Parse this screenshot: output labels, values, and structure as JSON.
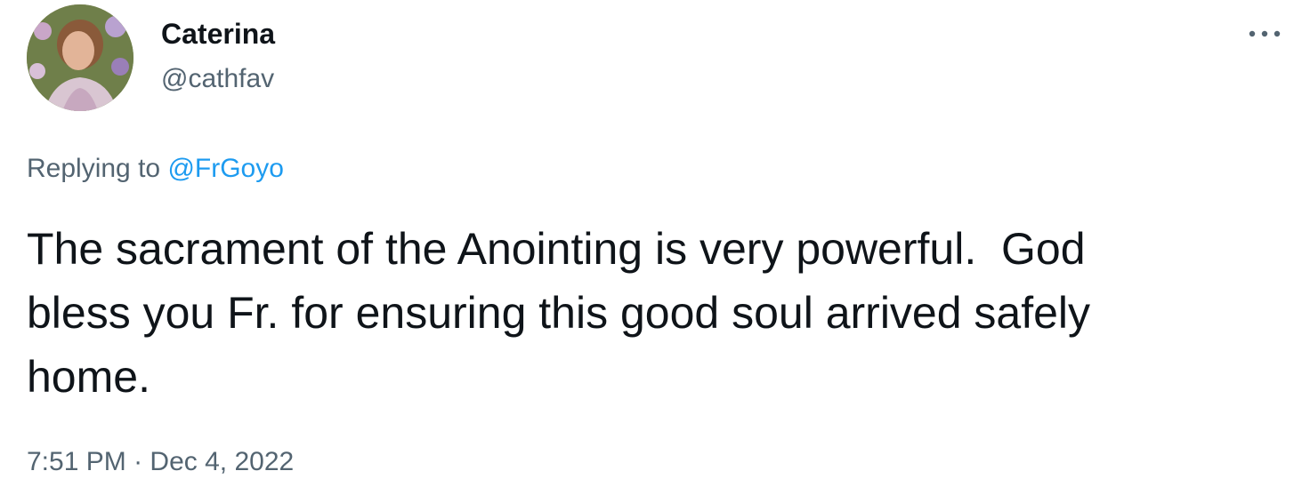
{
  "tweet": {
    "author": {
      "display_name": "Caterina",
      "handle": "@cathfav",
      "avatar_icon": "profile-photo"
    },
    "more_icon": "ellipsis-icon",
    "reply": {
      "prefix": "Replying to ",
      "mention": "@FrGoyo"
    },
    "text": "The sacrament of the Anointing is very powerful.  God\nbless you Fr. for ensuring this good soul arrived safely\nhome.",
    "time": "7:51 PM",
    "separator": " · ",
    "date": "Dec 4, 2022"
  },
  "colors": {
    "text_primary": "#0f1419",
    "text_secondary": "#536471",
    "link": "#1d9bf0",
    "background": "#ffffff"
  }
}
